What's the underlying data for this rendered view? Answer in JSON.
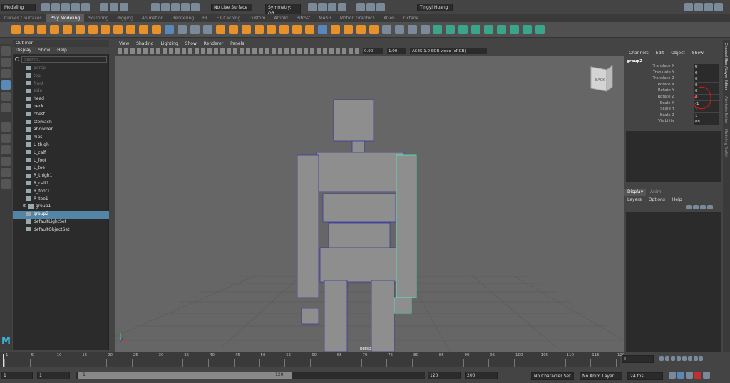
{
  "status": {
    "mode": "Modeling",
    "live_surface": "No Live Surface",
    "symmetry": "Symmetry: Off",
    "user": "Tingyi Huang"
  },
  "shelf_tabs": [
    "Curves / Surfaces",
    "Poly Modeling",
    "Sculpting",
    "Rigging",
    "Animation",
    "Rendering",
    "FX",
    "FX Caching",
    "Custom",
    "Arnold",
    "Bifrost",
    "MASH",
    "Motion Graphics",
    "XGen",
    "Octane"
  ],
  "shelf_active": "Poly Modeling",
  "outliner": {
    "title": "Outliner",
    "menu": [
      "Display",
      "Show",
      "Help"
    ],
    "search_placeholder": "Search...",
    "items": [
      {
        "label": "persp",
        "hidden": true
      },
      {
        "label": "top",
        "hidden": true
      },
      {
        "label": "front",
        "hidden": true
      },
      {
        "label": "side",
        "hidden": true
      },
      {
        "label": "head"
      },
      {
        "label": "neck"
      },
      {
        "label": "chest"
      },
      {
        "label": "stomach"
      },
      {
        "label": "abdomen"
      },
      {
        "label": "hips"
      },
      {
        "label": "L_thigh"
      },
      {
        "label": "L_calf"
      },
      {
        "label": "L_foot"
      },
      {
        "label": "L_toe"
      },
      {
        "label": "R_thigh1"
      },
      {
        "label": "R_calf1"
      },
      {
        "label": "R_foot1"
      },
      {
        "label": "R_toe1"
      },
      {
        "label": "group1",
        "expand": true
      },
      {
        "label": "group2",
        "selected": true
      },
      {
        "label": "defaultLightSet"
      },
      {
        "label": "defaultObjectSet"
      }
    ]
  },
  "viewport": {
    "menu": [
      "View",
      "Shading",
      "Lighting",
      "Show",
      "Renderer",
      "Panels"
    ],
    "exposure": "0.00",
    "gamma": "1.00",
    "colorspace": "ACES 1.0 SDR-video (sRGB)",
    "camera_label": "persp",
    "viewcube": "BACK"
  },
  "channel_box": {
    "menu": [
      "Channels",
      "Edit",
      "Object",
      "Show"
    ],
    "object": "group2",
    "rows": [
      {
        "label": "Translate X",
        "value": "0"
      },
      {
        "label": "Translate Y",
        "value": "0"
      },
      {
        "label": "Translate Z",
        "value": "0"
      },
      {
        "label": "Rotate X",
        "value": "0"
      },
      {
        "label": "Rotate Y",
        "value": "0"
      },
      {
        "label": "Rotate Z",
        "value": "0"
      },
      {
        "label": "Scale X",
        "value": "-1"
      },
      {
        "label": "Scale Y",
        "value": "1"
      },
      {
        "label": "Scale Z",
        "value": "1"
      },
      {
        "label": "Visibility",
        "value": "on"
      }
    ],
    "layer_tabs": [
      "Display",
      "Anim"
    ],
    "layer_menu": [
      "Layers",
      "Options",
      "Help"
    ]
  },
  "side_tabs": [
    "Channel Box / Layer Editor",
    "Attribute Editor",
    "Modeling Toolkit"
  ],
  "timeline": {
    "ticks": [
      "1",
      "5",
      "10",
      "15",
      "20",
      "25",
      "30",
      "35",
      "40",
      "45",
      "50",
      "55",
      "60",
      "65",
      "70",
      "75",
      "80",
      "85",
      "90",
      "95",
      "100",
      "105",
      "110",
      "115",
      "120"
    ],
    "current": "1"
  },
  "range": {
    "start": "1",
    "anim_start": "1",
    "slider_start": "1",
    "slider_end": "120",
    "anim_end_a": "120",
    "anim_end_b": "200",
    "character_set": "No Character Set",
    "anim_layer": "No Anim Layer",
    "fps": "24 fps"
  },
  "colors": {
    "selection": "#5285a6",
    "accent_orange": "#e8902a",
    "annotation_red": "#d01818",
    "wire_blue": "#3a3aa0",
    "wire_green": "#4ef0c0"
  }
}
